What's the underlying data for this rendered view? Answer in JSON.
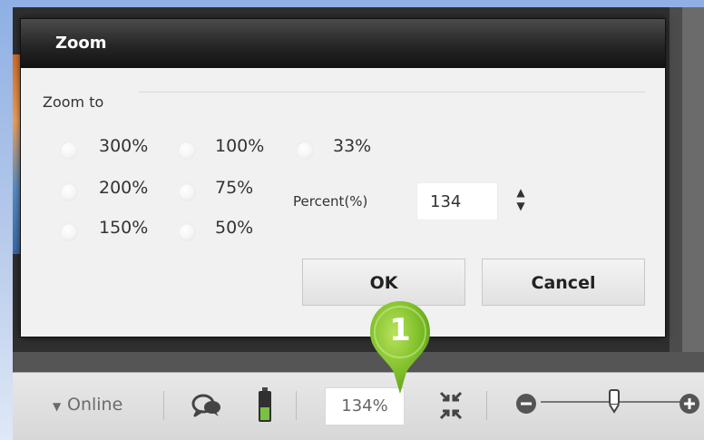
{
  "dialog": {
    "title": "Zoom",
    "section": "Zoom to",
    "options": [
      {
        "label": "300%"
      },
      {
        "label": "200%"
      },
      {
        "label": "150%"
      },
      {
        "label": "100%"
      },
      {
        "label": "75%"
      },
      {
        "label": "50%"
      },
      {
        "label": "33%"
      }
    ],
    "percent_label": "Percent(%)",
    "percent_value": "134",
    "ok_label": "OK",
    "cancel_label": "Cancel"
  },
  "statusbar": {
    "online_label": "Online",
    "zoom_value": "134%"
  },
  "callout": {
    "number": "1"
  },
  "icons": {
    "status_dropdown": "chevron-down-icon",
    "chat": "chat-bubbles-icon",
    "battery": "battery-icon",
    "fit": "shrink-to-fit-icon",
    "zoom_out": "zoom-out-icon",
    "zoom_in": "zoom-in-icon",
    "slider": "zoom-slider-thumb-icon"
  },
  "colors": {
    "callout_green": "#7fbf2a",
    "titlebar": "#222222",
    "battery_green": "#7cc043"
  }
}
